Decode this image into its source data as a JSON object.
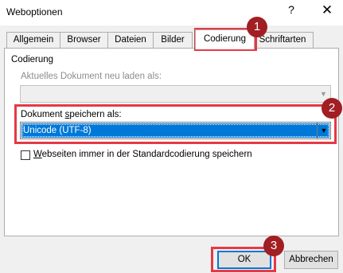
{
  "window": {
    "title": "Weboptionen",
    "help_label": "?",
    "close_label": "✕"
  },
  "tabs": [
    {
      "label": "Allgemein"
    },
    {
      "label": "Browser"
    },
    {
      "label": "Dateien"
    },
    {
      "label": "Bilder"
    },
    {
      "label": "Codierung"
    },
    {
      "label": "Schriftarten"
    }
  ],
  "active_tab": "Codierung",
  "panel": {
    "group_title": "Codierung",
    "reload_label": "Aktuelles Dokument neu laden als:",
    "reload_value": "",
    "save_label_pre": "Dokument ",
    "save_label_u": "s",
    "save_label_post": "peichern als:",
    "save_value": "Unicode (UTF-8)",
    "checkbox_u": "W",
    "checkbox_rest": "ebseiten immer in der Standardcodierung speichern",
    "checkbox_checked": false
  },
  "buttons": {
    "ok": "OK",
    "cancel": "Abbrechen"
  },
  "annotations": {
    "badge1": "1",
    "badge2": "2",
    "badge3": "3"
  },
  "colors": {
    "annotation_red": "#e53945",
    "badge_fill": "#a11e22",
    "selection_blue": "#0078d7"
  }
}
